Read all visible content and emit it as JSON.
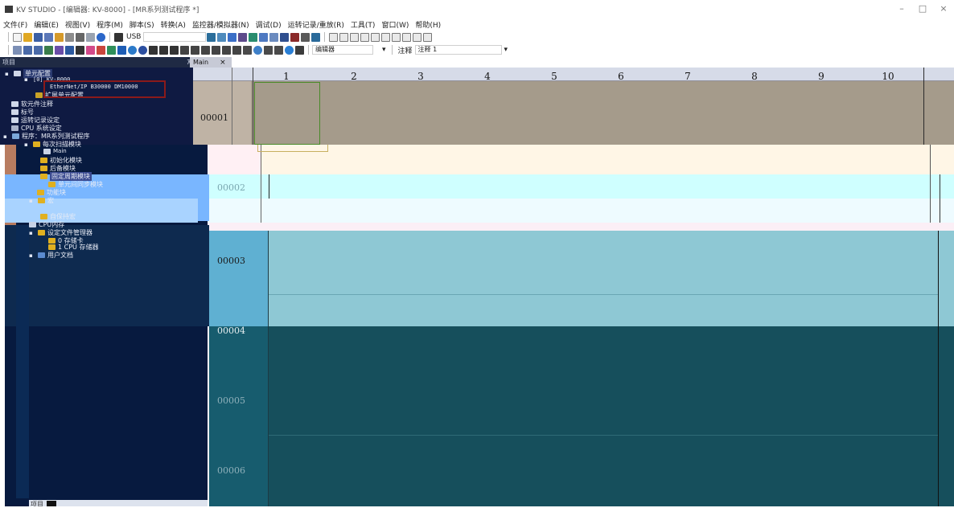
{
  "window": {
    "title": "KV STUDIO - [编辑器: KV-8000] - [MR系列测试程序 *]",
    "controls": [
      "–",
      "□",
      "×"
    ]
  },
  "menu": [
    "文件(F)",
    "编辑(E)",
    "视图(V)",
    "程序(M)",
    "脚本(S)",
    "转换(A)",
    "监控器/模拟器(N)",
    "调试(D)",
    "运转记录/重放(R)",
    "工具(T)",
    "窗口(W)",
    "帮助(H)"
  ],
  "toolbar": {
    "connection": "USB",
    "editor_mode": "编辑器",
    "comment_label": "注释",
    "comment_value": "注释 1"
  },
  "panel": {
    "header": "项目",
    "pin": "⊼",
    "close": "×",
    "footer": "项目"
  },
  "editor_tab": {
    "label": "Main",
    "close": "×"
  },
  "tree": {
    "unit_config": "单元配置",
    "cpu": "[0]  KV-8000",
    "ethernet": "EtherNet/IP   B30000  DM10000",
    "expansion": "扩展单元配置",
    "device_comment": "软元件注释",
    "label": "标号",
    "oplog": "运转记录设定",
    "cpu_system": "CPU 系统设定",
    "program": "程序：MR系列测试程序",
    "module": "每次扫描模块",
    "main": "Main",
    "init_module": "初始化模块",
    "standby_module": "后备模块",
    "fixed_period": "固定周期模块",
    "sync_module": "单元间同步模块",
    "function_block": "功能块",
    "macro": "宏",
    "self_hold": "自保持宏",
    "cpu_memory": "CPU内存",
    "setting_file": "设定文件管理器",
    "storage0": "0 存储卡",
    "storage1": "1 CPU 存储器",
    "user_doc": "用户文档"
  },
  "ladder": {
    "columns": [
      "1",
      "2",
      "3",
      "4",
      "5",
      "6",
      "7",
      "8",
      "9",
      "10"
    ],
    "rows": [
      "00001",
      "00002",
      "00003",
      "00004",
      "00005",
      "00006"
    ]
  }
}
